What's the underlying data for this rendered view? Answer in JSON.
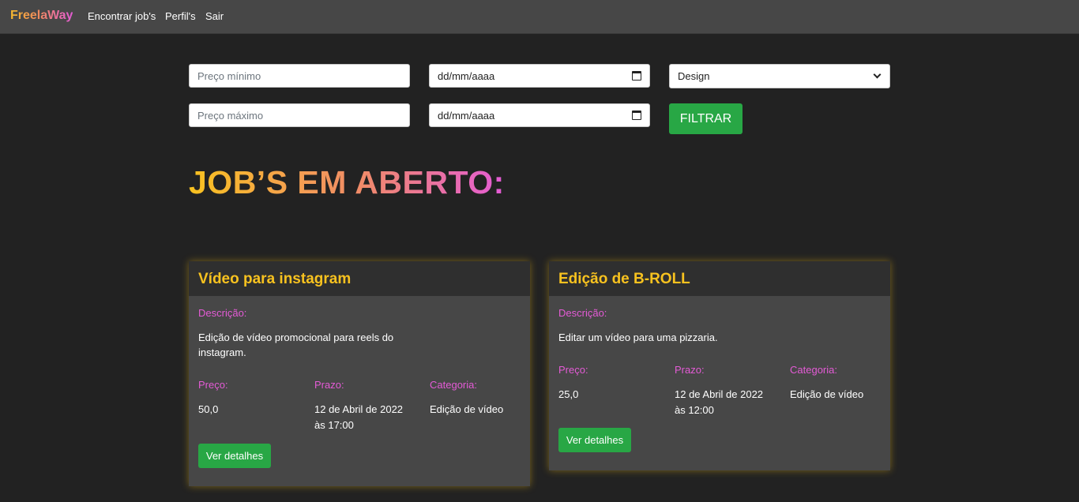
{
  "nav": {
    "brand": "FreelaWay",
    "links": [
      "Encontrar job's",
      "Perfil's",
      "Sair"
    ]
  },
  "filters": {
    "min_price_placeholder": "Preço mínimo",
    "max_price_placeholder": "Preço máximo",
    "date_from": "dd/mm/aaaa",
    "date_to": "dd/mm/aaaa",
    "category_selected": "Design",
    "filter_button": "FILTRAR"
  },
  "heading": "JOB’S EM ABERTO:",
  "labels": {
    "description": "Descrição:",
    "price": "Preço:",
    "deadline": "Prazo:",
    "category": "Categoria:",
    "details_button": "Ver detalhes"
  },
  "jobs": [
    {
      "title": "Vídeo para instagram",
      "description_line1": "Edição de vídeo promocional para reels do",
      "description_line2": "instagram.",
      "price": "50,0",
      "deadline_line1": "12 de Abril de 2022",
      "deadline_line2": "às 17:00",
      "category": "Edição de vídeo"
    },
    {
      "title": "Edição de B-ROLL",
      "description_line1": "Editar um vídeo para uma pizzaria.",
      "price": "25,0",
      "deadline_line1": "12 de Abril de 2022",
      "deadline_line2": "às 12:00",
      "category": "Edição de vídeo"
    }
  ],
  "colors": {
    "accent_yellow": "#f8c21f",
    "accent_pink": "#e45bd6",
    "button_green": "#28a745",
    "background": "#222222",
    "navbar": "#474747"
  }
}
